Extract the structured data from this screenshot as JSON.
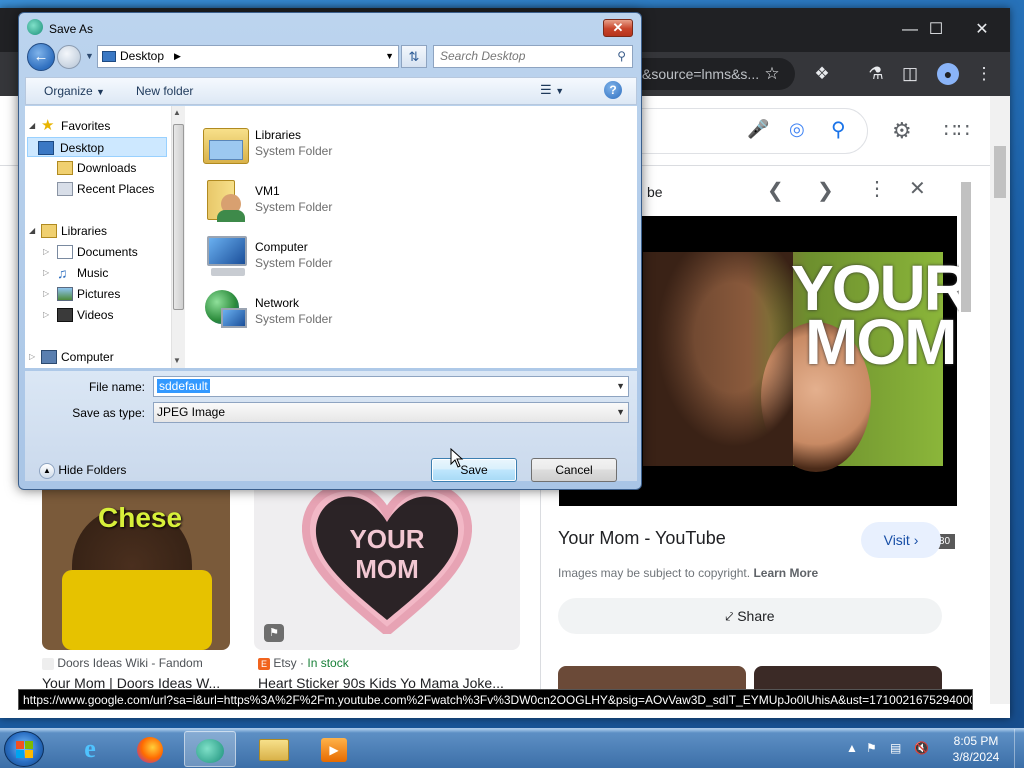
{
  "browser": {
    "omnibox_partial": "&source=lnms&s...",
    "panel": {
      "header_partial": "be",
      "image_text_1": "YOUR",
      "image_text_2": "MOM",
      "dimensions": "640 × 480",
      "title": "Your Mom - YouTube",
      "visit_label": "Visit",
      "copyright_text": "Images may be subject to copyright.",
      "learn_more": "Learn More",
      "share_label": "Share"
    },
    "results": [
      {
        "source": "Doors Ideas Wiki - Fandom",
        "title": "Your Mom | Doors Ideas W...",
        "overlay_text": "Chese"
      },
      {
        "source": "Etsy",
        "stock": "In stock",
        "title": "Heart Sticker 90s Kids Yo Mama Joke...",
        "overlay_text_1": "YOUR",
        "overlay_text_2": "MOM"
      }
    ],
    "status_url": "https://www.google.com/url?sa=i&url=https%3A%2F%2Fm.youtube.com%2Fwatch%3Fv%3DW0cn2OOGLHY&psig=AOvVaw3D_sdIT_EYMUpJo0lUhisA&ust=1710021675294000..."
  },
  "dialog": {
    "title": "Save As",
    "address": "Desktop",
    "search_placeholder": "Search Desktop",
    "toolbar": {
      "organize": "Organize",
      "new_folder": "New folder"
    },
    "nav": {
      "favorites": "Favorites",
      "desktop": "Desktop",
      "downloads": "Downloads",
      "recent_places": "Recent Places",
      "libraries": "Libraries",
      "documents": "Documents",
      "music": "Music",
      "pictures": "Pictures",
      "videos": "Videos",
      "computer": "Computer"
    },
    "items": [
      {
        "name": "Libraries",
        "type": "System Folder"
      },
      {
        "name": "VM1",
        "type": "System Folder"
      },
      {
        "name": "Computer",
        "type": "System Folder"
      },
      {
        "name": "Network",
        "type": "System Folder"
      }
    ],
    "file_name_label": "File name:",
    "file_name_value": "sddefault",
    "save_type_label": "Save as type:",
    "save_type_value": "JPEG Image",
    "hide_folders": "Hide Folders",
    "save_label": "Save",
    "cancel_label": "Cancel"
  },
  "taskbar": {
    "time": "8:05 PM",
    "date": "3/8/2024"
  }
}
